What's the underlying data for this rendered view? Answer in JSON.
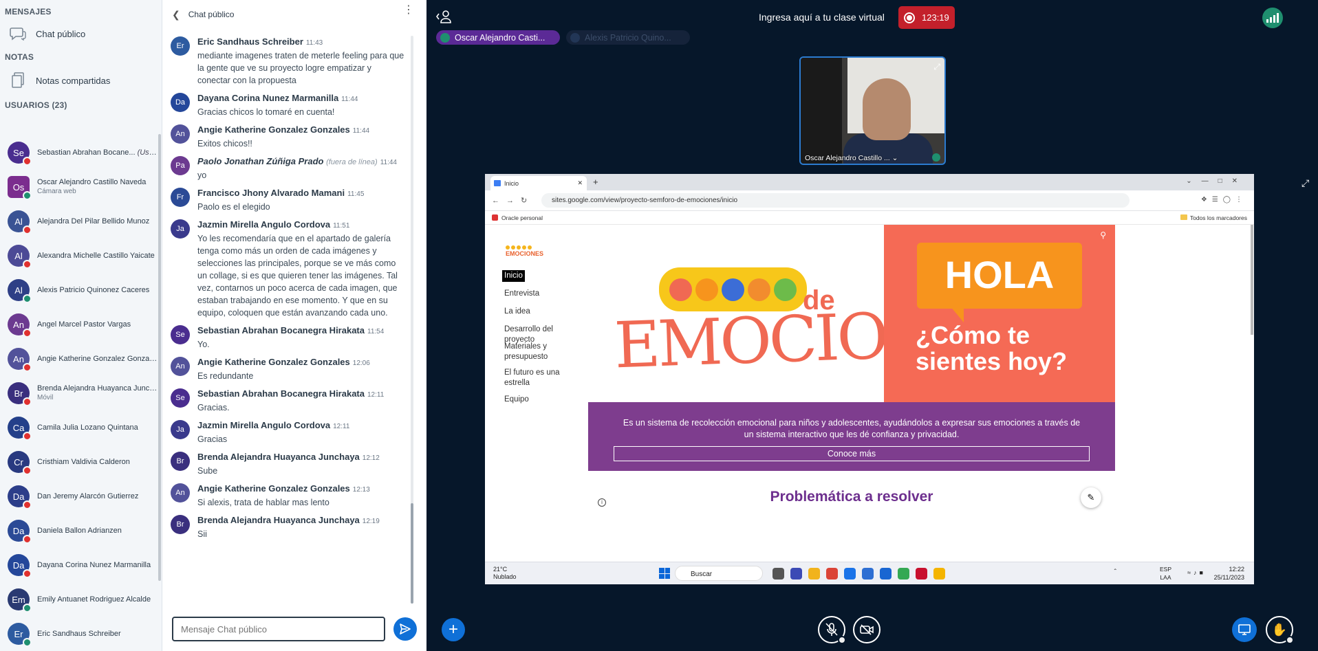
{
  "sidebar": {
    "messages_title": "MENSAJES",
    "public_chat": "Chat público",
    "notes_title": "NOTAS",
    "shared_notes": "Notas compartidas",
    "users_title": "USUARIOS (23)",
    "users": [
      {
        "initials": "Se",
        "name": "Sebastian Abrahan Bocane...",
        "you": "(Usted)",
        "color": "#4a2d8f",
        "sub": "",
        "status": "red",
        "square": false
      },
      {
        "initials": "Os",
        "name": "Oscar Alejandro Castillo Naveda",
        "you": "",
        "color": "#7b2d8e",
        "sub": "Cámara web",
        "status": "green",
        "square": true
      },
      {
        "initials": "Al",
        "name": "Alejandra Del Pilar Bellido Munoz",
        "you": "",
        "color": "#3a5394",
        "sub": "",
        "status": "red",
        "square": false
      },
      {
        "initials": "Al",
        "name": "Alexandra Michelle Castillo Yaicate",
        "you": "",
        "color": "#4c4a96",
        "sub": "",
        "status": "red",
        "square": false
      },
      {
        "initials": "Al",
        "name": "Alexis Patricio Quinonez Caceres",
        "you": "",
        "color": "#2e3f86",
        "sub": "",
        "status": "green",
        "square": false
      },
      {
        "initials": "An",
        "name": "Angel Marcel Pastor Vargas",
        "you": "",
        "color": "#6c3a90",
        "sub": "",
        "status": "red",
        "square": false
      },
      {
        "initials": "An",
        "name": "Angie Katherine Gonzalez Gonzales",
        "you": "",
        "color": "#52529a",
        "sub": "",
        "status": "red",
        "square": false
      },
      {
        "initials": "Br",
        "name": "Brenda Alejandra Huayanca Junch...",
        "you": "",
        "color": "#3a2f7e",
        "sub": "Móvil",
        "status": "red",
        "square": false
      },
      {
        "initials": "Ca",
        "name": "Camila Julia Lozano Quintana",
        "you": "",
        "color": "#24408a",
        "sub": "",
        "status": "red",
        "square": false
      },
      {
        "initials": "Cr",
        "name": "Cristhiam Valdivia Calderon",
        "you": "",
        "color": "#293a80",
        "sub": "",
        "status": "red",
        "square": false
      },
      {
        "initials": "Da",
        "name": "Dan Jeremy Alarcón Gutierrez",
        "you": "",
        "color": "#2c3e8a",
        "sub": "",
        "status": "red",
        "square": false
      },
      {
        "initials": "Da",
        "name": "Daniela Ballon Adrianzen",
        "you": "",
        "color": "#2b4a96",
        "sub": "",
        "status": "red",
        "square": false
      },
      {
        "initials": "Da",
        "name": "Dayana Corina Nunez Marmanilla",
        "you": "",
        "color": "#24479a",
        "sub": "",
        "status": "red",
        "square": false
      },
      {
        "initials": "Em",
        "name": "Emily Antuanet Rodriguez Alcalde",
        "you": "",
        "color": "#2a3a72",
        "sub": "",
        "status": "green",
        "square": false
      },
      {
        "initials": "Er",
        "name": "Eric Sandhaus Schreiber",
        "you": "",
        "color": "#2d5ba0",
        "sub": "",
        "status": "green",
        "square": false
      }
    ]
  },
  "chat": {
    "title": "Chat público",
    "input_placeholder": "Mensaje Chat público",
    "messages": [
      {
        "initials": "Er",
        "color": "#2d5ba0",
        "name": "Eric Sandhaus Schreiber",
        "time": "11:43",
        "off": "",
        "text": "mediante imagenes traten de meterle feeling para que la gente que ve su proyecto logre empatizar y conectar con la propuesta"
      },
      {
        "initials": "Da",
        "color": "#24479a",
        "name": "Dayana Corina Nunez Marmanilla",
        "time": "11:44",
        "off": "",
        "text": "Gracias chicos lo tomaré en cuenta!"
      },
      {
        "initials": "An",
        "color": "#52529a",
        "name": "Angie Katherine Gonzalez Gonzales",
        "time": "11:44",
        "off": "",
        "text": "Exitos chicos!!"
      },
      {
        "initials": "Pa",
        "color": "#6c3a90",
        "name": "Paolo Jonathan Zúñiga Prado",
        "time": "11:44",
        "off": "(fuera de línea)",
        "text": "yo"
      },
      {
        "initials": "Fr",
        "color": "#2b4a96",
        "name": "Francisco Jhony Alvarado Mamani",
        "time": "11:45",
        "off": "",
        "text": "Paolo es el elegido"
      },
      {
        "initials": "Ja",
        "color": "#3a3a8c",
        "name": "Jazmin Mirella Angulo Cordova",
        "time": "11:51",
        "off": "",
        "text": "Yo les recomendaría que en el apartado de galería tenga como más un orden de cada imágenes y selecciones las principales, porque se ve más como un collage, si es que quieren tener las imágenes. Tal vez, contarnos un poco acerca de cada imagen, que estaban trabajando en ese momento. Y que en su equipo, coloquen que están avanzando cada uno."
      },
      {
        "initials": "Se",
        "color": "#4a2d8f",
        "name": "Sebastian Abrahan Bocanegra Hirakata",
        "time": "11:54",
        "off": "",
        "text": "Yo."
      },
      {
        "initials": "An",
        "color": "#52529a",
        "name": "Angie Katherine Gonzalez Gonzales",
        "time": "12:06",
        "off": "",
        "text": "Es redundante"
      },
      {
        "initials": "Se",
        "color": "#4a2d8f",
        "name": "Sebastian Abrahan Bocanegra Hirakata",
        "time": "12:11",
        "off": "",
        "text": "Gracias."
      },
      {
        "initials": "Ja",
        "color": "#3a3a8c",
        "name": "Jazmin Mirella Angulo Cordova",
        "time": "12:11",
        "off": "",
        "text": "Gracias"
      },
      {
        "initials": "Br",
        "color": "#3a2f7e",
        "name": "Brenda Alejandra Huayanca Junchaya",
        "time": "12:12",
        "off": "",
        "text": "Sube"
      },
      {
        "initials": "An",
        "color": "#52529a",
        "name": "Angie Katherine Gonzalez Gonzales",
        "time": "12:13",
        "off": "",
        "text": "Si alexis, trata de hablar mas lento"
      },
      {
        "initials": "Br",
        "color": "#3a2f7e",
        "name": "Brenda Alejandra Huayanca Junchaya",
        "time": "12:19",
        "off": "",
        "text": "Sii"
      }
    ]
  },
  "stage": {
    "title": "Ingresa aquí a tu clase virtual",
    "record_time": "123:19",
    "talker_1": "Oscar Alejandro Casti...",
    "talker_2": "Alexis Patricio Quino...",
    "video_name": "Oscar Alejandro Castillo ...",
    "colors": {
      "accent": "#0f70d7",
      "record": "#c3202b",
      "talking": "#5b2a96",
      "connection": "#1f8f6f",
      "background": "#06172a"
    }
  },
  "screenshare": {
    "tab_title": "Inicio",
    "url": "sites.google.com/view/proyecto-semforo-de-emociones/inicio",
    "bookmark_left": "Oracle personal",
    "bookmark_right": "Todos los marcadores",
    "logo_text": "EMOCIONES",
    "nav": [
      "Inicio",
      "Entrevista",
      "La idea",
      "Desarrollo del proyecto",
      "Materiales y presupuesto",
      "El futuro es una estrella",
      "Equipo"
    ],
    "hero_word_main": "EMOCIONES",
    "hero_word_de": "de",
    "hola": "HOLA",
    "como": "¿Cómo te sientes hoy?",
    "description": "Es un sistema de recolección emocional para niños y adolescentes, ayudándolos a expresar sus emociones a través de un sistema interactivo que les dé confianza y privacidad.",
    "cta": "Conoce más",
    "section_title": "Problemática a resolver",
    "taskbar": {
      "temp": "21°C",
      "weather": "Nublado",
      "search": "Buscar",
      "lang_1": "ESP",
      "lang_2": "LAA",
      "time": "12:22",
      "date": "25/11/2023"
    }
  }
}
